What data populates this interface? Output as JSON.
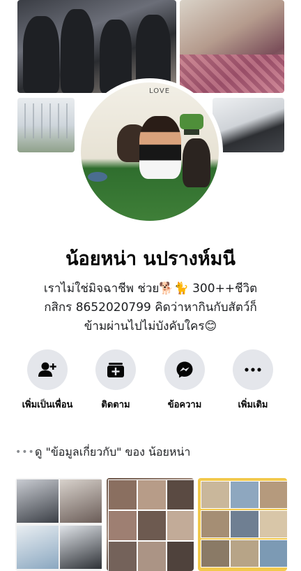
{
  "profile": {
    "name": "น้อยหน่า นปรางห์มนี",
    "bio_lines": [
      "เราไม่ใช่มิจฉาชีพ ช่วย🐕🐈 300++ชีวิต",
      "กสิกร 8652020799 คิดว่าหากินกับสัตว์ก็",
      "ข้ามผ่านไปไม่บังคับใคร😊"
    ],
    "avatar_text": "LOVE"
  },
  "actions": [
    {
      "label": "เพิ่มเป็นเพื่อน",
      "icon": "add-friend-icon"
    },
    {
      "label": "ติดตาม",
      "icon": "follow-icon"
    },
    {
      "label": "ข้อความ",
      "icon": "messenger-icon"
    },
    {
      "label": "เพิ่มเติม",
      "icon": "more-icon"
    }
  ],
  "about": {
    "dots": "•••",
    "text": "ดู \"ข้อมูลเกี่ยวกับ\" ของ น้อยหน่า"
  },
  "colors": {
    "button_bg": "#e4e6eb",
    "text": "#050505"
  }
}
